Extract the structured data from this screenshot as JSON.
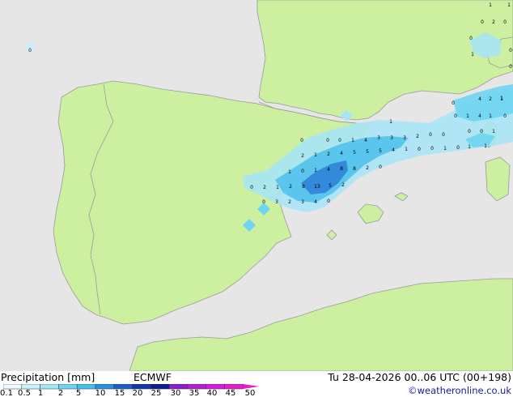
{
  "footer": {
    "title": "Precipitation [mm]",
    "model": "ECMWF",
    "datetime": "Tu 28-04-2026 00..06 UTC (00+198)",
    "credit": "©weatheronline.co.uk"
  },
  "legend": {
    "ticks": [
      "0.1",
      "0.5",
      "1",
      "2",
      "5",
      "10",
      "15",
      "20",
      "25",
      "30",
      "35",
      "40",
      "45",
      "50"
    ],
    "colors": [
      "#f0fbff",
      "#c9f1fb",
      "#9fe6f8",
      "#6fd4f2",
      "#45bfea",
      "#2b8fd8",
      "#1c5fc4",
      "#1238a8",
      "#0b1e8c",
      "#8a1ec8",
      "#b41ed2",
      "#d21edc",
      "#e61ec8"
    ]
  },
  "map": {
    "sea_color": "#e6e6e6",
    "land_color": "#ccf0a0",
    "border_color": "#9a9a9a",
    "rain_light": "#a8e4f5",
    "rain_medium": "#52c2ec",
    "rain_heavy": "#2d7fd6",
    "values": [
      {
        "text": "0"
      },
      {
        "text": "1"
      },
      {
        "text": "1"
      },
      {
        "text": "0"
      },
      {
        "text": "2"
      },
      {
        "text": "0"
      },
      {
        "text": "1"
      },
      {
        "text": "0"
      },
      {
        "text": "0"
      },
      {
        "text": "0"
      },
      {
        "text": "1"
      },
      {
        "text": "0"
      },
      {
        "text": "4"
      },
      {
        "text": "2"
      },
      {
        "text": "1"
      },
      {
        "text": "0"
      },
      {
        "text": "1"
      },
      {
        "text": "4"
      },
      {
        "text": "1"
      },
      {
        "text": "0"
      },
      {
        "text": "0"
      },
      {
        "text": "0"
      },
      {
        "text": "1"
      },
      {
        "text": "1"
      },
      {
        "text": "0"
      },
      {
        "text": "0"
      },
      {
        "text": "0"
      },
      {
        "text": "1"
      },
      {
        "text": "4"
      },
      {
        "text": "3"
      },
      {
        "text": "3"
      },
      {
        "text": "3"
      },
      {
        "text": "2"
      },
      {
        "text": "0"
      },
      {
        "text": "0"
      },
      {
        "text": "2"
      },
      {
        "text": "1"
      },
      {
        "text": "2"
      },
      {
        "text": "4"
      },
      {
        "text": "5"
      },
      {
        "text": "5"
      },
      {
        "text": "5"
      },
      {
        "text": "4"
      },
      {
        "text": "1"
      },
      {
        "text": "0"
      },
      {
        "text": "0"
      },
      {
        "text": "1"
      },
      {
        "text": "0"
      },
      {
        "text": "1"
      },
      {
        "text": "1"
      },
      {
        "text": "1"
      },
      {
        "text": "0"
      },
      {
        "text": "1"
      },
      {
        "text": "4"
      },
      {
        "text": "8"
      },
      {
        "text": "8"
      },
      {
        "text": "2"
      },
      {
        "text": "0"
      },
      {
        "text": "0"
      },
      {
        "text": "2"
      },
      {
        "text": "1"
      },
      {
        "text": "2"
      },
      {
        "text": "8"
      },
      {
        "text": "13"
      },
      {
        "text": "5"
      },
      {
        "text": "2"
      },
      {
        "text": "0"
      },
      {
        "text": "3"
      },
      {
        "text": "2"
      },
      {
        "text": "3"
      },
      {
        "text": "4"
      },
      {
        "text": "0"
      }
    ]
  }
}
